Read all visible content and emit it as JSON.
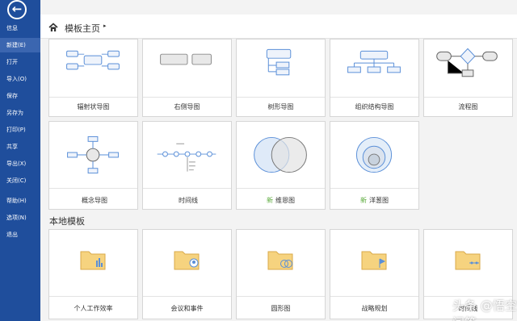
{
  "sidebar": {
    "back_icon": "arrow-left-circle-icon",
    "items": [
      "信息",
      "新建(E)",
      "打开",
      "导入(O)",
      "保存",
      "另存为",
      "打印(P)",
      "共享",
      "导出(X)",
      "关闭(C)",
      "帮助(H)",
      "选项(N)",
      "退出"
    ],
    "active_index": 1
  },
  "header": {
    "home_icon": "home-icon",
    "title": "模板主页",
    "chevron": "▸"
  },
  "templates_row1": [
    {
      "label": "辐射状导图",
      "icon": "radial-map-icon"
    },
    {
      "label": "右侧导图",
      "icon": "right-map-icon"
    },
    {
      "label": "树形导图",
      "icon": "tree-map-icon"
    },
    {
      "label": "组织结构导图",
      "icon": "org-chart-icon"
    },
    {
      "label": "流程图",
      "icon": "flowchart-icon"
    }
  ],
  "templates_row2": [
    {
      "label": "概念导图",
      "icon": "concept-map-icon",
      "new": ""
    },
    {
      "label": "时间线",
      "icon": "timeline-icon",
      "new": ""
    },
    {
      "label": "维恩图",
      "icon": "venn-icon",
      "new": "新"
    },
    {
      "label": "洋葱图",
      "icon": "onion-icon",
      "new": "新"
    }
  ],
  "local_section_title": "本地模板",
  "local_templates": [
    {
      "label": "个人工作效率",
      "icon": "folder-chart-icon"
    },
    {
      "label": "会议和事件",
      "icon": "folder-user-icon"
    },
    {
      "label": "圆形图",
      "icon": "folder-circles-icon"
    },
    {
      "label": "战略规划",
      "icon": "folder-flag-icon"
    },
    {
      "label": "时间线",
      "icon": "folder-timeline-icon"
    }
  ],
  "watermark": "头条 @悟空问答",
  "colors": {
    "sidebar": "#1f4e9c",
    "sidebar_active": "#3b66b0",
    "new_badge": "#5aaa3a",
    "folder": "#f6d37f",
    "diagram_blue": "#5a8fd8"
  }
}
